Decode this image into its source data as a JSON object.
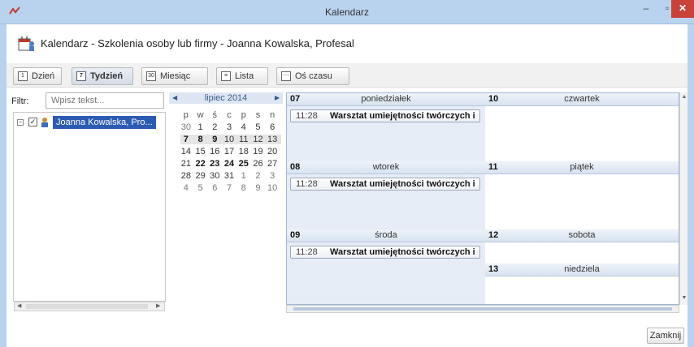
{
  "window": {
    "title": "Kalendarz"
  },
  "header": {
    "title": "Kalendarz - Szkolenia osoby lub firmy - Joanna Kowalska, Profesal"
  },
  "toolbar": {
    "day": "Dzień",
    "week": "Tydzień",
    "month": "Miesiąc",
    "list": "Lista",
    "timeline": "Oś czasu"
  },
  "filter": {
    "label": "Filtr:",
    "placeholder": "Wpisz tekst..."
  },
  "tree": {
    "item_label": "Joanna Kowalska, Pro..."
  },
  "minical": {
    "month_label": "lipiec 2014",
    "weekdays": [
      "p",
      "w",
      "ś",
      "c",
      "p",
      "s",
      "n"
    ],
    "weeks": [
      [
        "30",
        "1",
        "2",
        "3",
        "4",
        "5",
        "6"
      ],
      [
        "7",
        "8",
        "9",
        "10",
        "11",
        "12",
        "13"
      ],
      [
        "14",
        "15",
        "16",
        "17",
        "18",
        "19",
        "20"
      ],
      [
        "21",
        "22",
        "23",
        "24",
        "25",
        "26",
        "27"
      ],
      [
        "28",
        "29",
        "30",
        "31",
        "1",
        "2",
        "3"
      ],
      [
        "4",
        "5",
        "6",
        "7",
        "8",
        "9",
        "10"
      ]
    ],
    "current_week_index": 1,
    "bold_days": [
      "7",
      "8",
      "9",
      "22",
      "23",
      "24",
      "25"
    ]
  },
  "week": {
    "days": [
      {
        "num": "07",
        "name": "poniedziałek",
        "event": {
          "time": "11:28",
          "title": "Warsztat umiejętności twórczych i"
        }
      },
      {
        "num": "08",
        "name": "wtorek",
        "event": {
          "time": "11:28",
          "title": "Warsztat umiejętności twórczych i"
        }
      },
      {
        "num": "09",
        "name": "środa",
        "event": {
          "time": "11:28",
          "title": "Warsztat umiejętności twórczych i"
        }
      },
      {
        "num": "10",
        "name": "czwartek"
      },
      {
        "num": "11",
        "name": "piątek"
      },
      {
        "num": "12",
        "name": "sobota"
      },
      {
        "num": "13",
        "name": "niedziela"
      }
    ]
  },
  "footer": {
    "close_label": "Zamknij"
  },
  "colors": {
    "titlebar": "#b9d3ee",
    "selection": "#2c5bb4",
    "close": "#c9423a"
  }
}
